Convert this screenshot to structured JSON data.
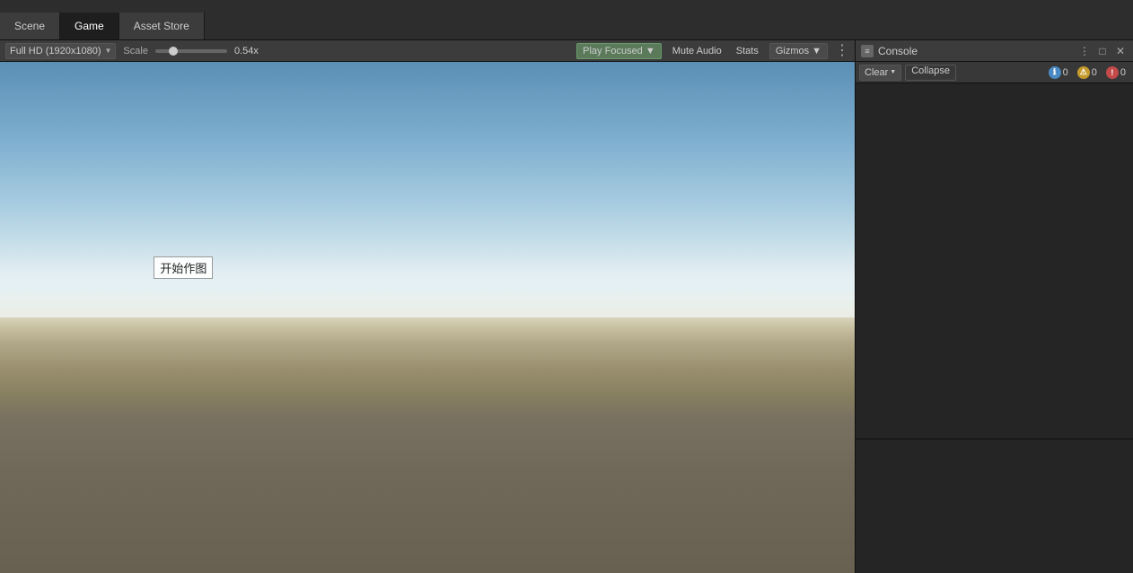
{
  "tabs": {
    "items": [
      "Scene",
      "Game",
      "Asset Store"
    ]
  },
  "game_toolbar": {
    "resolution_label": "Full HD (1920x1080)",
    "scale_label": "Scale",
    "scale_value": "0.54x",
    "play_focused_label": "Play Focused",
    "mute_audio_label": "Mute Audio",
    "stats_label": "Stats",
    "gizmos_label": "Gizmos",
    "three_dots": "⋮"
  },
  "scene": {
    "label_text": "开始作图"
  },
  "console": {
    "title": "Console",
    "icon": "≡",
    "toolbar": {
      "clear_label": "Clear",
      "collapse_label": "Collapse",
      "info_count": "0",
      "warn_count": "0",
      "error_count": "0"
    },
    "header_icons": {
      "more": "⋮",
      "expand": "□",
      "close": "✕"
    }
  }
}
